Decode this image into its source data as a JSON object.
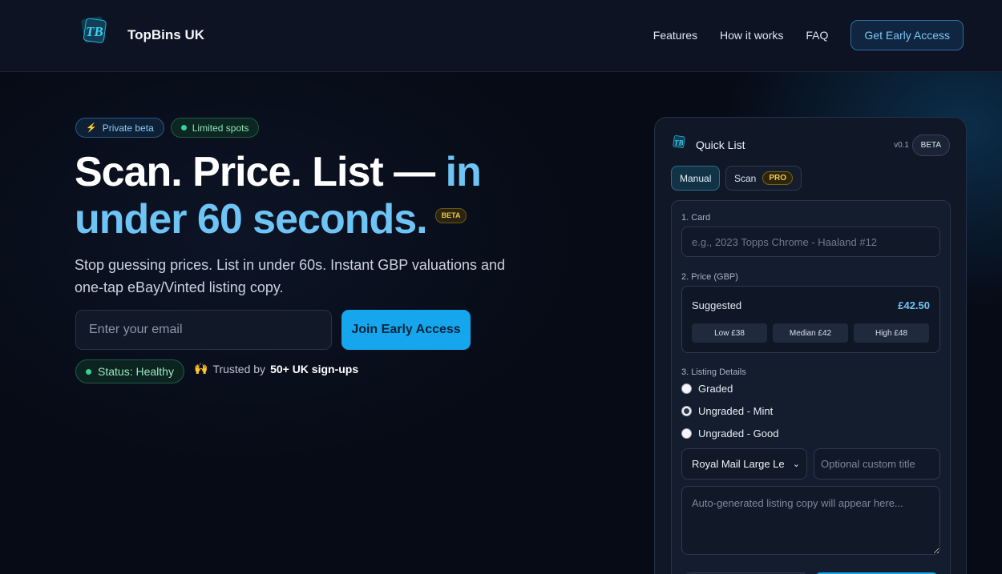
{
  "header": {
    "brand": "TopBins UK",
    "logo_icon": "tb-logo-icon",
    "nav": [
      "Features",
      "How it works",
      "FAQ"
    ],
    "cta": "Get Early Access"
  },
  "hero": {
    "pills": [
      {
        "icon": "bolt-icon",
        "label": "Private beta"
      },
      {
        "icon": "status-dot-icon",
        "label": "Limited spots"
      }
    ],
    "title_line1": "Scan. Price. List —",
    "title_accent_1": "in",
    "title_accent_2": "under 60 seconds.",
    "title_badge": "BETA",
    "subtitle": "Stop guessing prices. List in under 60s. Instant GBP valuations and one-tap eBay/Vinted listing copy.",
    "email_placeholder": "Enter your email",
    "join_label": "Join Early Access",
    "status": "Status: Healthy",
    "trusted_prefix": "Trusted by",
    "trusted_bold": "50+ UK sign-ups",
    "trusted_icon": "raised-hands-icon"
  },
  "quick_list": {
    "title": "Quick List",
    "version": "v0.1",
    "beta": "BETA",
    "tabs": {
      "manual": "Manual",
      "scan": "Scan",
      "scan_badge": "PRO"
    },
    "card_label": "1. Card",
    "card_placeholder": "e.g., 2023 Topps Chrome - Haaland #12",
    "price_label": "2. Price (GBP)",
    "suggested_label": "Suggested",
    "suggested_value": "£42.50",
    "low": "Low £38",
    "median": "Median £42",
    "high": "High £48",
    "listing_label": "3. Listing Details",
    "radios": [
      {
        "label": "Graded",
        "checked": false
      },
      {
        "label": "Ungraded - Mint",
        "checked": true
      },
      {
        "label": "Ungraded - Good",
        "checked": false
      }
    ],
    "shipping_selected": "Royal Mail Large Le",
    "custom_title_placeholder": "Optional custom title",
    "listing_copy_placeholder": "Auto-generated listing copy will appear here..."
  },
  "colors": {
    "accent": "#6ec4f5",
    "button": "#15a6ee",
    "background": "#070b16",
    "success": "#34d399",
    "gold": "#f5c84b"
  }
}
